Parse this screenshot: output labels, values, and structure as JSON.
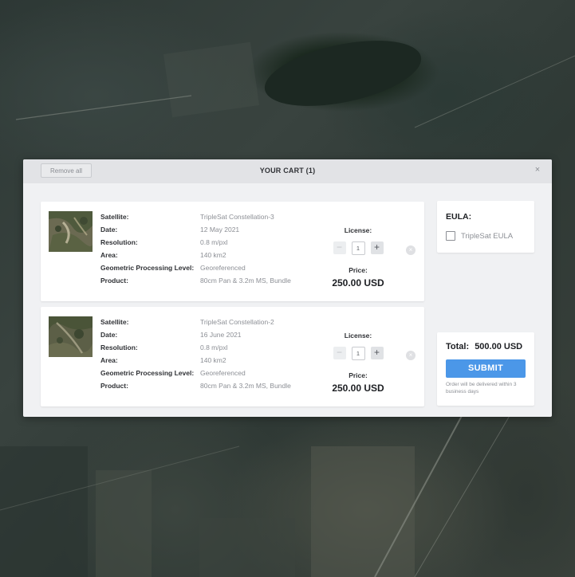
{
  "cart": {
    "title": "YOUR CART (1)",
    "remove_all_label": "Remove all",
    "close_glyph": "×"
  },
  "items": [
    {
      "specs": [
        {
          "label": "Satellite:",
          "value": "TripleSat Constellation-3"
        },
        {
          "label": "Date:",
          "value": "12 May 2021"
        },
        {
          "label": "Resolution:",
          "value": "0.8 m/pxl"
        },
        {
          "label": "Area:",
          "value": "140 km2"
        },
        {
          "label": "Geometric Processing Level:",
          "value": "Georeferenced"
        },
        {
          "label": "Product:",
          "value": "80cm Pan & 3.2m MS, Bundle"
        }
      ],
      "license_label": "License:",
      "quantity": "1",
      "minus_glyph": "−",
      "plus_glyph": "+",
      "price_label": "Price:",
      "price": "250.00 USD",
      "remove_glyph": "×"
    },
    {
      "specs": [
        {
          "label": "Satellite:",
          "value": "TripleSat Constellation-2"
        },
        {
          "label": "Date:",
          "value": "16 June 2021"
        },
        {
          "label": "Resolution:",
          "value": "0.8 m/pxl"
        },
        {
          "label": "Area:",
          "value": "140 km2"
        },
        {
          "label": "Geometric Processing Level:",
          "value": "Georeferenced"
        },
        {
          "label": "Product:",
          "value": "80cm Pan & 3.2m MS, Bundle"
        }
      ],
      "license_label": "License:",
      "quantity": "1",
      "minus_glyph": "−",
      "plus_glyph": "+",
      "price_label": "Price:",
      "price": "250.00 USD",
      "remove_glyph": "×"
    }
  ],
  "eula": {
    "title": "EULA:",
    "checkbox_label": "TripleSat EULA",
    "checked": false
  },
  "summary": {
    "total_label": "Total:",
    "total_value": "500.00 USD",
    "submit_label": "SUBMIT",
    "delivery_note": "Order will be delivered within 3 business days"
  },
  "colors": {
    "accent": "#4b97e8",
    "modal_bg": "#f0f1f3",
    "header_bg": "#e2e3e6"
  },
  "icons": {
    "close": "close-icon",
    "remove_item": "remove-item-icon",
    "minus": "minus-icon",
    "plus": "plus-icon",
    "checkbox": "checkbox-icon"
  }
}
